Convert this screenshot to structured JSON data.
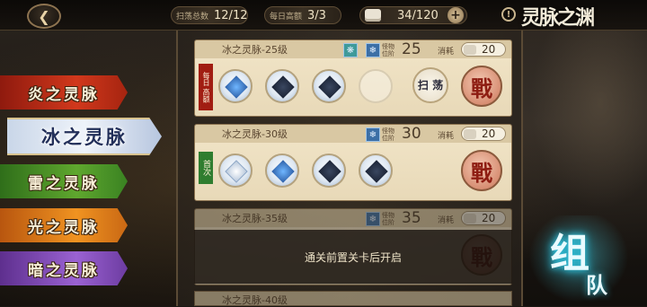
{
  "topbar": {
    "back_icon": "back-arrow-icon",
    "sweep_total_label": "扫荡总数",
    "sweep_total_value": "12/12",
    "daily_quota_label": "每日高额",
    "daily_quota_value": "3/3",
    "stamina_value": "34/120",
    "plus_label": "+",
    "info_label": "!",
    "game_title": "灵脉之渊"
  },
  "tabs": [
    {
      "label": "炎之灵脉",
      "selected": false,
      "color": "#d1381c"
    },
    {
      "label": "冰之灵脉",
      "selected": true,
      "color": "#eef3fa"
    },
    {
      "label": "雷之灵脉",
      "selected": false,
      "color": "#5fa72e"
    },
    {
      "label": "光之灵脉",
      "selected": false,
      "color": "#f09321"
    },
    {
      "label": "暗之灵脉",
      "selected": false,
      "color": "#9a62d2"
    }
  ],
  "stages": [
    {
      "name": "冰之灵脉-25级",
      "level_label": "怪物 位阶",
      "level": "25",
      "cost_label": "消耗",
      "cost": "20",
      "ribbon": "每日 高额",
      "sweep_label": "扫 荡",
      "battle_label": "戰"
    },
    {
      "name": "冰之灵脉-30级",
      "level_label": "怪物 位阶",
      "level": "30",
      "cost_label": "消耗",
      "cost": "20",
      "ribbon": "首次",
      "battle_label": "戰"
    },
    {
      "name": "冰之灵脉-35级",
      "level_label": "怪物 位阶",
      "level": "35",
      "cost_label": "消耗",
      "cost": "20",
      "battle_label": "戰",
      "locked_text": "通关前置关卡后开启"
    },
    {
      "name": "冰之灵脉-40级"
    }
  ],
  "team_button": {
    "glyph_1": "组",
    "glyph_2": "队"
  }
}
